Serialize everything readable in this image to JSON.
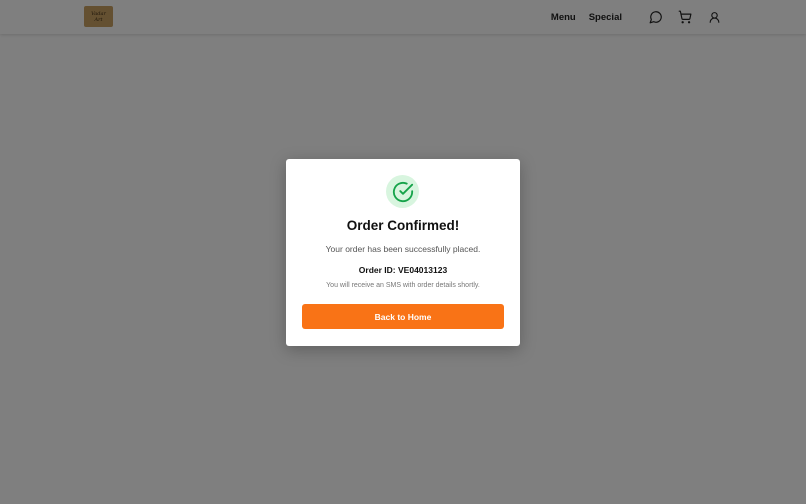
{
  "header": {
    "logo_text": [
      "Vadar",
      "Art"
    ],
    "nav": {
      "menu_label": "Menu",
      "special_label": "Special"
    },
    "icons": [
      "chat-icon",
      "cart-icon",
      "user-icon"
    ]
  },
  "modal": {
    "icon": "check-circle-icon",
    "title": "Order Confirmed!",
    "message": "Your order has been successfully placed.",
    "order_id_label": "Order ID:",
    "order_id_value": "VE04013123",
    "sms_note": "You will receive an SMS with order details shortly.",
    "button_label": "Back to Home"
  },
  "colors": {
    "accent": "#f97316",
    "success": "#16a34a",
    "success_bg": "#d8f5df",
    "overlay": "rgba(0,0,0,0.5)"
  }
}
